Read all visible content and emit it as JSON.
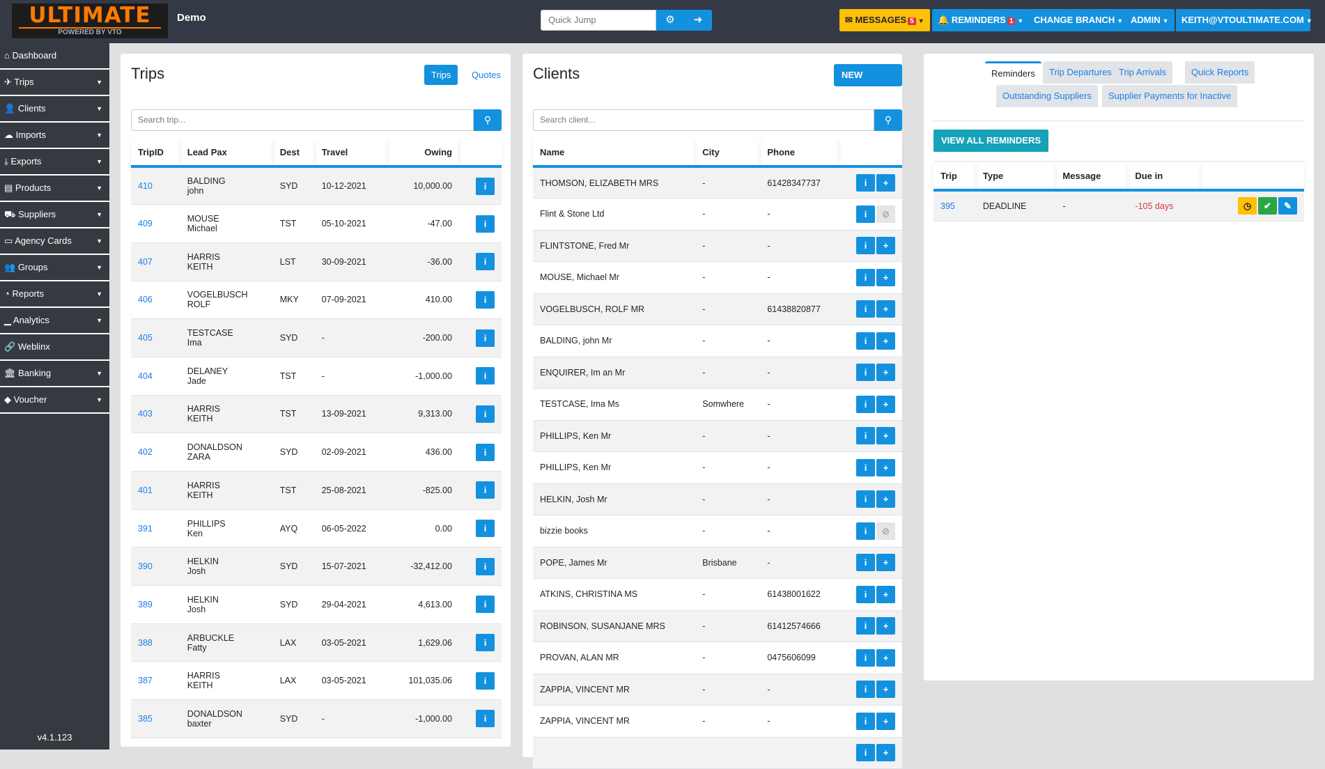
{
  "header": {
    "logo_text": "ULTIMATE",
    "logo_sub": "POWERED BY VTO",
    "title": "Demo",
    "quick_jump_placeholder": "Quick Jump",
    "messages": "MESSAGES",
    "messages_count": "5",
    "reminders": "REMINDERS",
    "reminders_count": "1",
    "change_branch": "CHANGE BRANCH",
    "admin": "ADMIN",
    "user": "KEITH@VTOULTIMATE.COM"
  },
  "sidebar": {
    "items": [
      {
        "label": "Dashboard",
        "icon": "⌂",
        "dd": false
      },
      {
        "label": "Trips",
        "icon": "✈",
        "dd": true
      },
      {
        "label": "Clients",
        "icon": "👤",
        "dd": true
      },
      {
        "label": "Imports",
        "icon": "☁",
        "dd": true
      },
      {
        "label": "Exports",
        "icon": "⤓",
        "dd": true
      },
      {
        "label": "Products",
        "icon": "▤",
        "dd": true
      },
      {
        "label": "Suppliers",
        "icon": "⛟",
        "dd": true
      },
      {
        "label": "Agency Cards",
        "icon": "▭",
        "dd": true
      },
      {
        "label": "Groups",
        "icon": "👥",
        "dd": true
      },
      {
        "label": "Reports",
        "icon": "◔",
        "dd": true
      },
      {
        "label": "Analytics",
        "icon": "▁",
        "dd": true
      },
      {
        "label": "Weblinx",
        "icon": "🔗",
        "dd": false
      },
      {
        "label": "Banking",
        "icon": "🏛",
        "dd": true
      },
      {
        "label": "Voucher",
        "icon": "◆",
        "dd": true
      }
    ],
    "version": "v4.1.123"
  },
  "trips": {
    "title": "Trips",
    "tab_trips": "Trips",
    "tab_quotes": "Quotes",
    "search_placeholder": "Search trip...",
    "columns": [
      "TripID",
      "Lead Pax",
      "Dest",
      "Travel",
      "Owing"
    ],
    "rows": [
      [
        "410",
        "BALDING",
        "john",
        "SYD",
        "10-12-2021",
        "10,000.00"
      ],
      [
        "409",
        "MOUSE",
        "Michael",
        "TST",
        "05-10-2021",
        "-47.00"
      ],
      [
        "407",
        "HARRIS",
        "KEITH",
        "LST",
        "30-09-2021",
        "-36.00"
      ],
      [
        "406",
        "VOGELBUSCH",
        "ROLF",
        "MKY",
        "07-09-2021",
        "410.00"
      ],
      [
        "405",
        "TESTCASE",
        "Ima",
        "SYD",
        "-",
        "-200.00"
      ],
      [
        "404",
        "DELANEY",
        "Jade",
        "TST",
        "-",
        "-1,000.00"
      ],
      [
        "403",
        "HARRIS",
        "KEITH",
        "TST",
        "13-09-2021",
        "9,313.00"
      ],
      [
        "402",
        "DONALDSON",
        "ZARA",
        "SYD",
        "02-09-2021",
        "436.00"
      ],
      [
        "401",
        "HARRIS",
        "KEITH",
        "TST",
        "25-08-2021",
        "-825.00"
      ],
      [
        "391",
        "PHILLIPS",
        "Ken",
        "AYQ",
        "06-05-2022",
        "0.00"
      ],
      [
        "390",
        "HELKIN",
        "Josh",
        "SYD",
        "15-07-2021",
        "-32,412.00"
      ],
      [
        "389",
        "HELKIN",
        "Josh",
        "SYD",
        "29-04-2021",
        "4,613.00"
      ],
      [
        "388",
        "ARBUCKLE",
        "Fatty",
        "LAX",
        "03-05-2021",
        "1,629.06"
      ],
      [
        "387",
        "HARRIS",
        "KEITH",
        "LAX",
        "03-05-2021",
        "101,035.06"
      ],
      [
        "385",
        "DONALDSON",
        "baxter",
        "SYD",
        "-",
        "-1,000.00"
      ]
    ]
  },
  "clients": {
    "title": "Clients",
    "new_client": "NEW CLIENT",
    "search_placeholder": "Search client...",
    "columns": [
      "Name",
      "City",
      "Phone"
    ],
    "rows": [
      [
        "THOMSON, ELIZABETH MRS",
        "-",
        "61428347737",
        true
      ],
      [
        "Flint & Stone Ltd",
        "-",
        "-",
        false
      ],
      [
        "FLINTSTONE, Fred Mr",
        "-",
        "-",
        true
      ],
      [
        "MOUSE, Michael Mr",
        "-",
        "-",
        true
      ],
      [
        "VOGELBUSCH, ROLF MR",
        "-",
        "61438820877",
        true
      ],
      [
        "BALDING, john Mr",
        "-",
        "-",
        true
      ],
      [
        "ENQUIRER, Im an Mr",
        "-",
        "-",
        true
      ],
      [
        "TESTCASE, Ima Ms",
        "Somwhere",
        "-",
        true
      ],
      [
        "PHILLIPS, Ken Mr",
        "-",
        "-",
        true
      ],
      [
        "PHILLIPS, Ken Mr",
        "-",
        "-",
        true
      ],
      [
        "HELKIN, Josh Mr",
        "-",
        "-",
        true
      ],
      [
        "bizzie books",
        "-",
        "-",
        false
      ],
      [
        "POPE, James Mr",
        "Brisbane",
        "-",
        true
      ],
      [
        "ATKINS, CHRISTINA MS",
        "-",
        "61438001622",
        true
      ],
      [
        "ROBINSON, SUSANJANE MRS",
        "-",
        "61412574666",
        true
      ],
      [
        "PROVAN, ALAN MR",
        "-",
        "0475606099",
        true
      ],
      [
        "ZAPPIA, VINCENT MR",
        "-",
        "-",
        true
      ],
      [
        "ZAPPIA, VINCENT MR",
        "-",
        "-",
        true
      ]
    ]
  },
  "reminders": {
    "tabs": [
      "Reminders",
      "Trip Departures",
      "Trip Arrivals",
      "Quick Reports",
      "Outstanding Suppliers",
      "Supplier Payments for Inactive"
    ],
    "view_all": "VIEW ALL REMINDERS",
    "columns": [
      "Trip",
      "Type",
      "Message",
      "Due in"
    ],
    "rows": [
      [
        "395",
        "DEADLINE",
        "-",
        "-105 days"
      ]
    ]
  },
  "colors": {
    "primary": "#1391de",
    "warning": "#ffc107",
    "success": "#28a745",
    "info": "#17a2b8",
    "danger": "#dc3545"
  }
}
